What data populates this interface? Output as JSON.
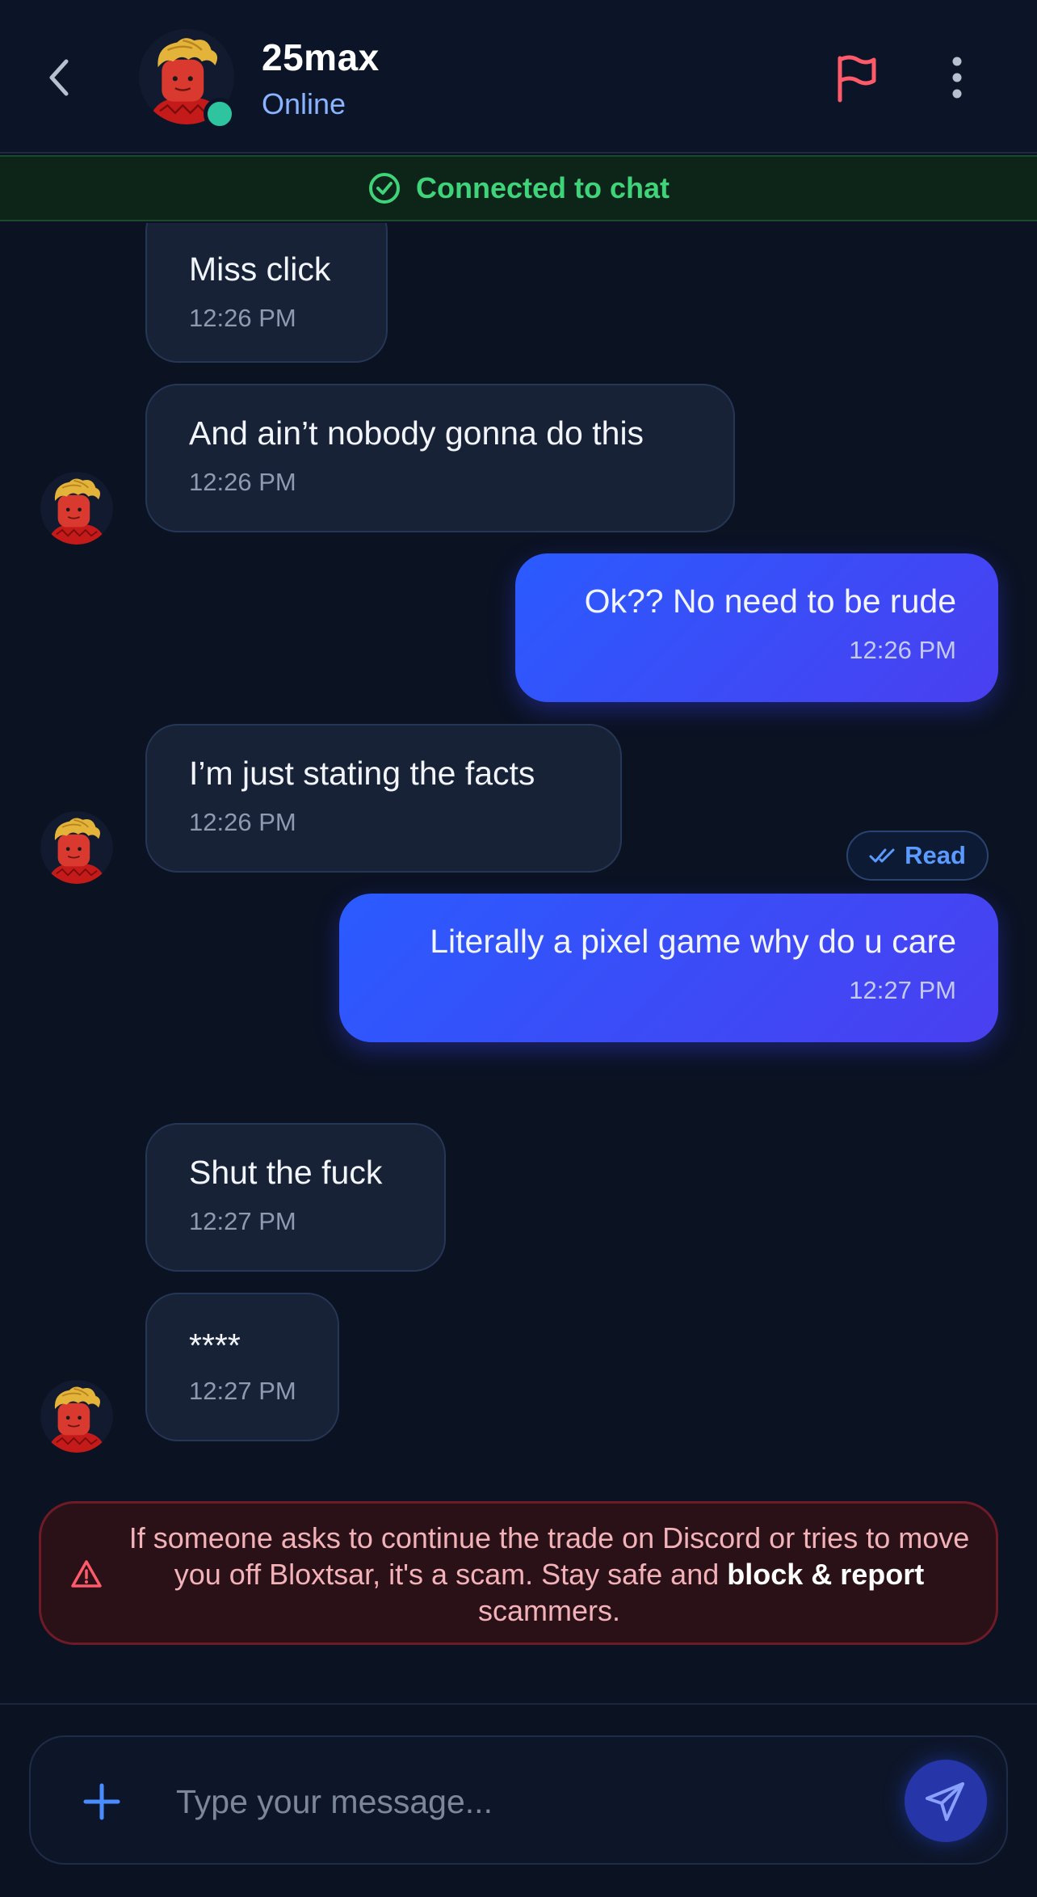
{
  "header": {
    "username": "25max",
    "status": "Online"
  },
  "banner": {
    "connected_text": "Connected to chat"
  },
  "messages": [
    {
      "direction": "in",
      "text": "Miss click",
      "time": "12:26 PM"
    },
    {
      "direction": "in",
      "text": "And ain’t nobody gonna do this",
      "time": "12:26 PM"
    },
    {
      "direction": "out",
      "text": "Ok?? No need to be rude",
      "time": "12:26 PM"
    },
    {
      "direction": "in",
      "text": "I’m just stating the facts",
      "time": "12:26 PM"
    },
    {
      "direction": "out",
      "text": "Literally a pixel game why do u care",
      "time": "12:27 PM"
    },
    {
      "direction": "in",
      "text": "Shut the fuck",
      "time": "12:27 PM"
    },
    {
      "direction": "in",
      "text": "****",
      "time": "12:27 PM"
    }
  ],
  "read_receipt": "Read",
  "warning": {
    "text_before": "If someone asks to continue the trade on Discord or tries to move you off Bloxtsar, it's a scam. Stay safe and ",
    "bold_text": "block & report",
    "text_after": " scammers."
  },
  "composer": {
    "placeholder": "Type your message..."
  },
  "colors": {
    "background": "#0b1222",
    "outgoing_bubble": "#2a5bff",
    "incoming_bubble": "#172236",
    "online": "#2ec4a0",
    "connected": "#3fd37a",
    "warning": "#f3b2b8",
    "flag": "#ff5a6a"
  },
  "icons": [
    "back-chevron-icon",
    "flag-icon",
    "more-vertical-icon",
    "check-circle-icon",
    "double-check-icon",
    "warning-triangle-icon",
    "plus-icon",
    "send-icon"
  ]
}
